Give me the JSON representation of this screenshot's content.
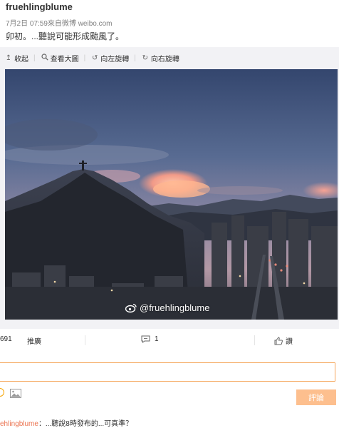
{
  "post": {
    "username": "fruehlingblume",
    "meta": "7月2日 07:59來自微博 weibo.com",
    "text": "卯初。...聽說可能形成颱風了。"
  },
  "toolbar": {
    "collapse_label": "收起",
    "view_large_label": "查看大圖",
    "rotate_left_label": "向左旋轉",
    "rotate_right_label": "向右旋轉"
  },
  "image": {
    "watermark": "@fruehlingblume",
    "subject": "Evening sky over a hill and city skyline"
  },
  "actions": {
    "repost_count": "691",
    "promote_label": "推廣",
    "comment_count": "1",
    "like_label": "讚"
  },
  "comment_box": {
    "value": "",
    "submit_label": "評論"
  },
  "reply": {
    "author": "ehlingblume",
    "text": "：...聽說8時發布的...可真準？"
  },
  "colors": {
    "accent": "#eb7350",
    "submit_bg": "#fdbf8e",
    "input_border": "#f5a65b"
  }
}
